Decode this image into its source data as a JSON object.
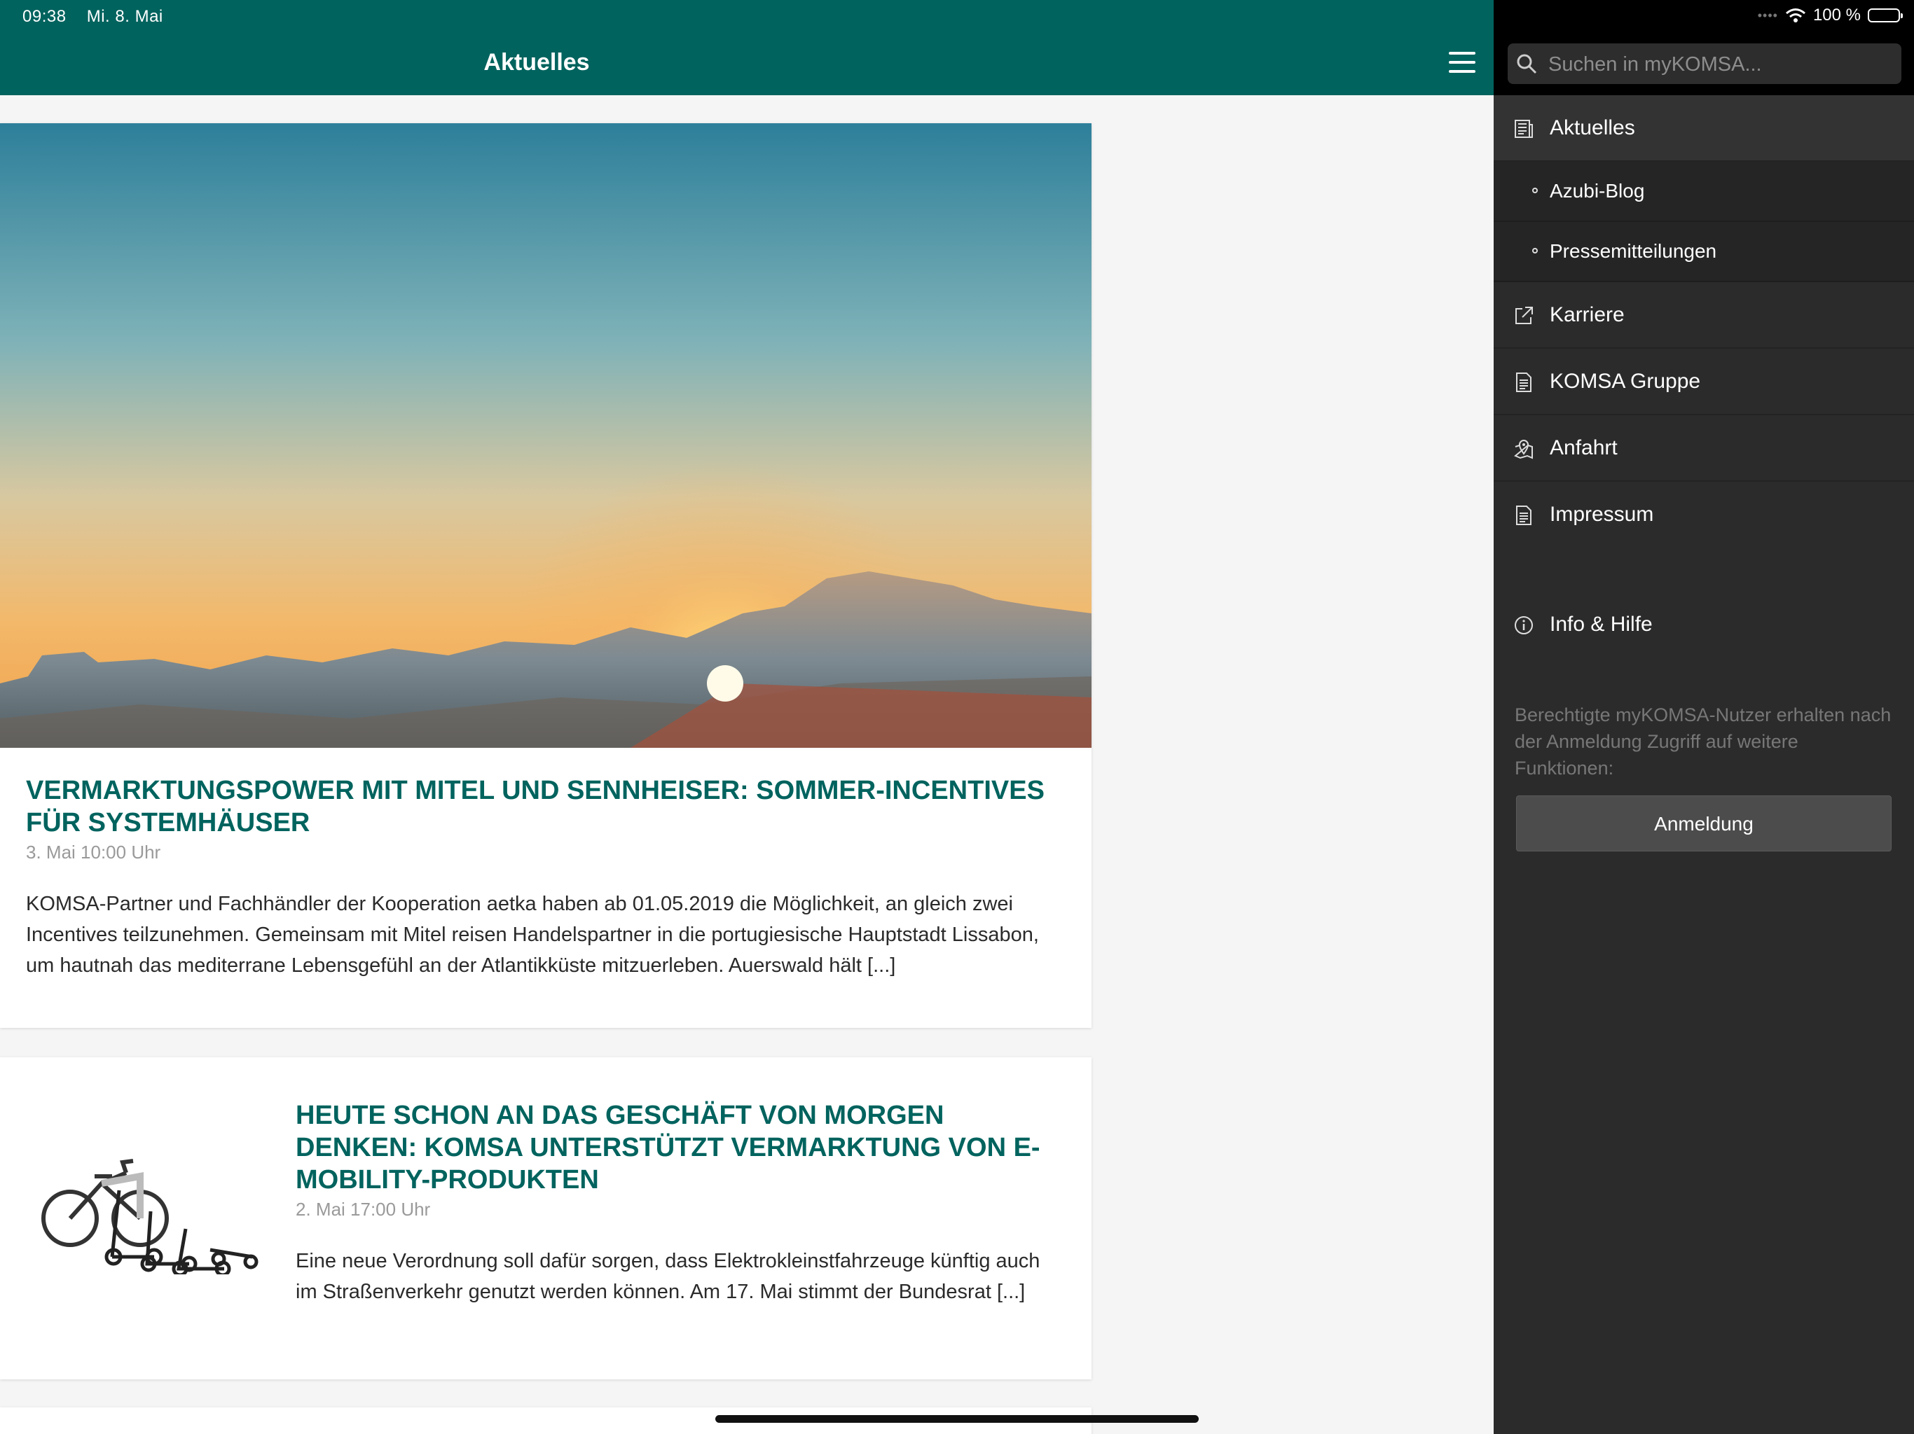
{
  "status_bar": {
    "time": "09:38",
    "date": "Mi. 8. Mai",
    "battery": "100 %"
  },
  "header": {
    "title": "Aktuelles"
  },
  "articles": [
    {
      "title": "Vermarktungspower mit Mitel und Sennheiser: Sommer-Incentives für Systemhäuser",
      "date": "3. Mai 10:00 Uhr",
      "excerpt": "KOMSA-Partner und Fachhändler der Kooperation aetka haben ab 01.05.2019 die Möglichkeit, an gleich zwei Incentives teilzunehmen. Gemeinsam mit Mitel reisen Handelspartner in die portugiesische Hauptstadt Lissabon, um hautnah das mediterrane Lebensgefühl an der Atlantikküste mitzuerleben. Auerswald hält [...]"
    },
    {
      "title": "Heute schon an das Geschäft von morgen denken: KOMSA unterstützt Vermarktung von E-Mobility-Produkten",
      "date": "2. Mai 17:00 Uhr",
      "excerpt": "Eine neue Verordnung soll dafür sorgen, dass Elektrokleinstfahrzeuge künftig auch im Straßenverkehr genutzt werden können. Am 17. Mai stimmt der Bundesrat [...]"
    }
  ],
  "sidebar": {
    "search_placeholder": "Suchen in myKOMSA...",
    "items": {
      "aktuelles": {
        "label": "Aktuelles",
        "icon": "news-icon"
      },
      "azubi_blog": {
        "label": "Azubi-Blog"
      },
      "pressemitteilungen": {
        "label": "Pressemitteilungen"
      },
      "karriere": {
        "label": "Karriere",
        "icon": "external-link-icon"
      },
      "komsa_gruppe": {
        "label": "KOMSA Gruppe",
        "icon": "document-icon"
      },
      "anfahrt": {
        "label": "Anfahrt",
        "icon": "map-pin-icon"
      },
      "impressum": {
        "label": "Impressum",
        "icon": "document-icon"
      },
      "info_hilfe": {
        "label": "Info & Hilfe",
        "icon": "info-icon"
      }
    },
    "info_text": "Berechtigte myKOMSA-Nutzer erhalten nach der Anmeldung Zugriff auf weitere Funktionen:",
    "login_label": "Anmeldung"
  },
  "colors": {
    "brand": "#00635e",
    "sidebar_bg": "#2b2b2b"
  }
}
